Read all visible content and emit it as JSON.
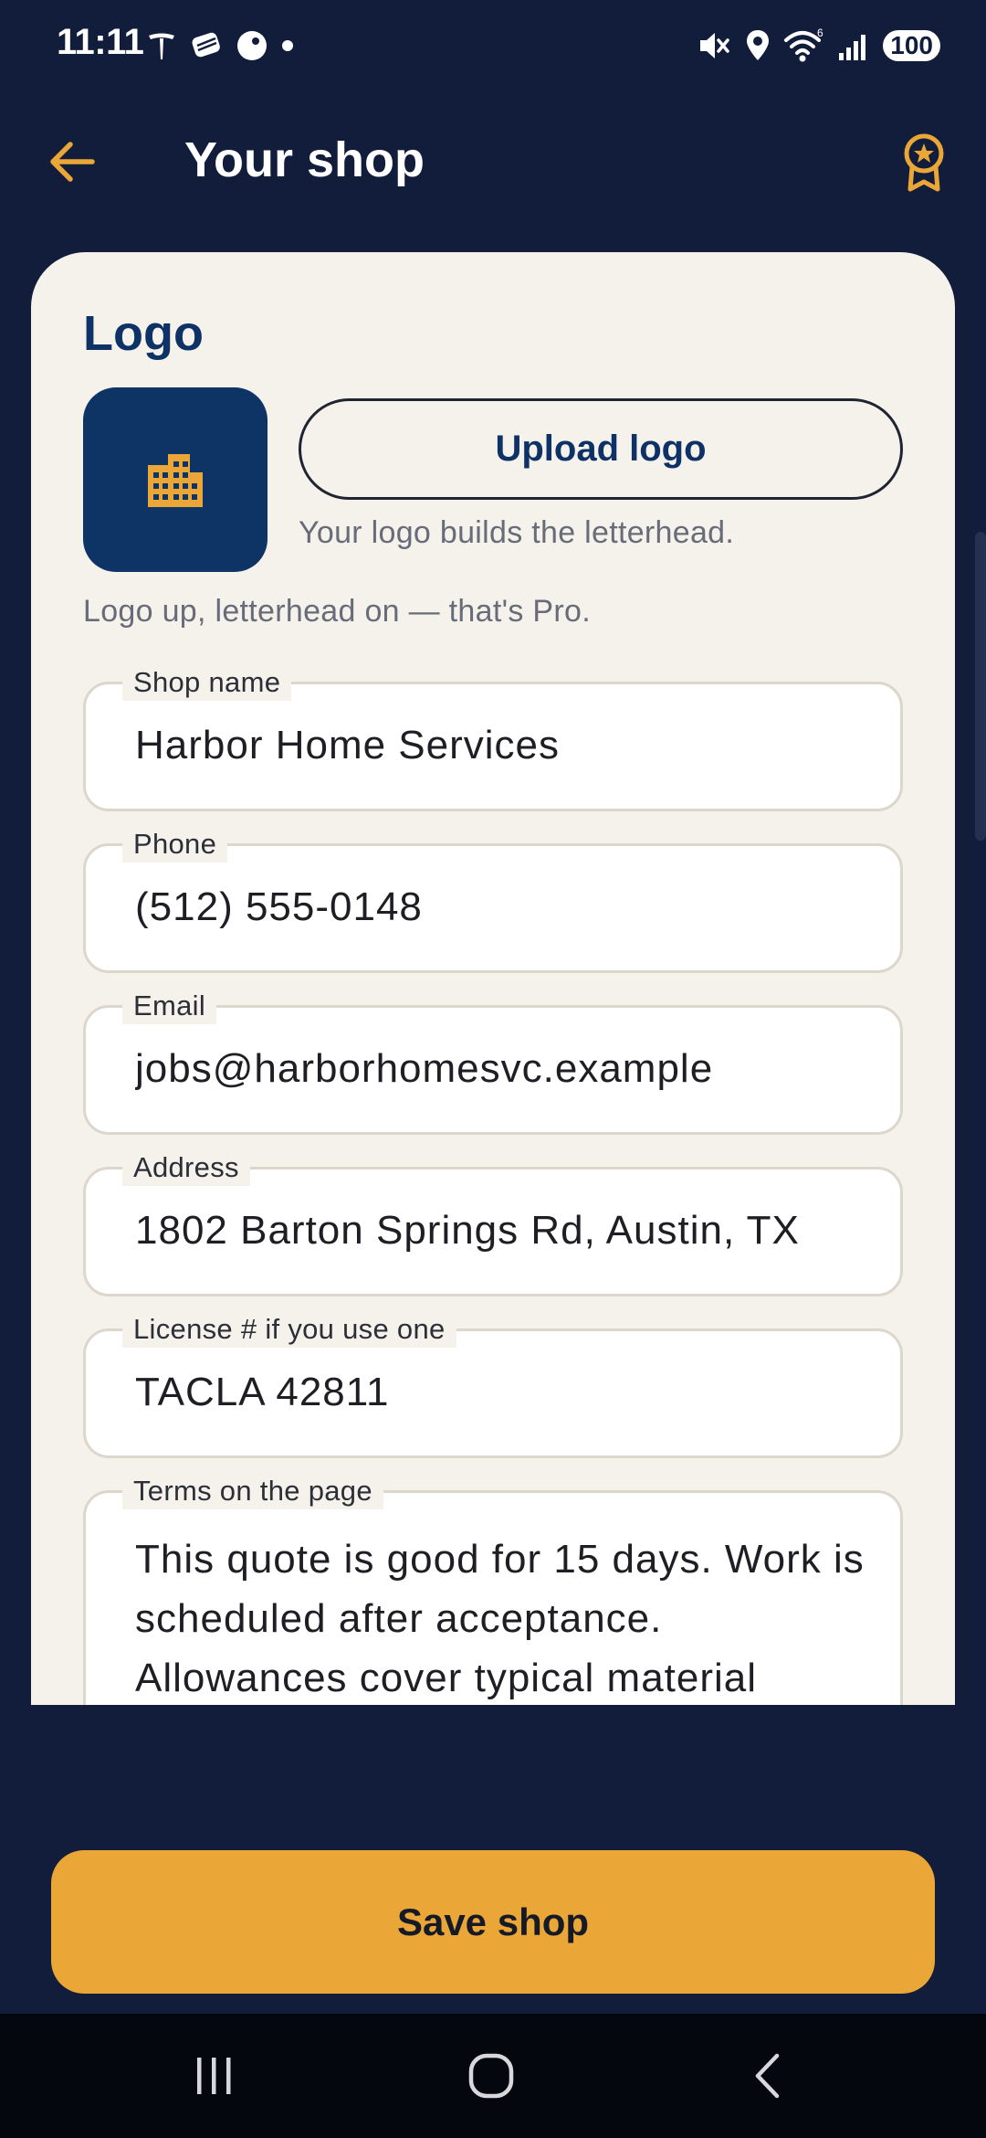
{
  "status_bar": {
    "time": "11:11",
    "battery": "100"
  },
  "app_bar": {
    "title": "Your shop"
  },
  "logo_section": {
    "title": "Logo",
    "upload_button": "Upload logo",
    "hint": "Your logo builds the letterhead.",
    "pro_note": "Logo up, letterhead on — that's Pro."
  },
  "fields": [
    {
      "label": "Shop name",
      "value": "Harbor Home Services"
    },
    {
      "label": "Phone",
      "value": "(512) 555-0148"
    },
    {
      "label": "Email",
      "value": "jobs@harborhomesvc.example"
    },
    {
      "label": "Address",
      "value": "1802 Barton Springs Rd, Austin, TX"
    },
    {
      "label": "License # if you use one",
      "value": "TACLA 42811"
    },
    {
      "label": "Terms on the page",
      "value": "This quote is good for 15 days. Work is scheduled after acceptance. Allowances cover typical material"
    }
  ],
  "save_button": "Save shop",
  "colors": {
    "background": "#121d3c",
    "card": "#f5f2ec",
    "accent": "#eba638",
    "primary_text": "#0f3266",
    "logo_tile": "#0e3466"
  },
  "icons": {
    "back": "arrow-left-icon",
    "award": "award-badge-icon",
    "logo_placeholder": "building-icon"
  }
}
